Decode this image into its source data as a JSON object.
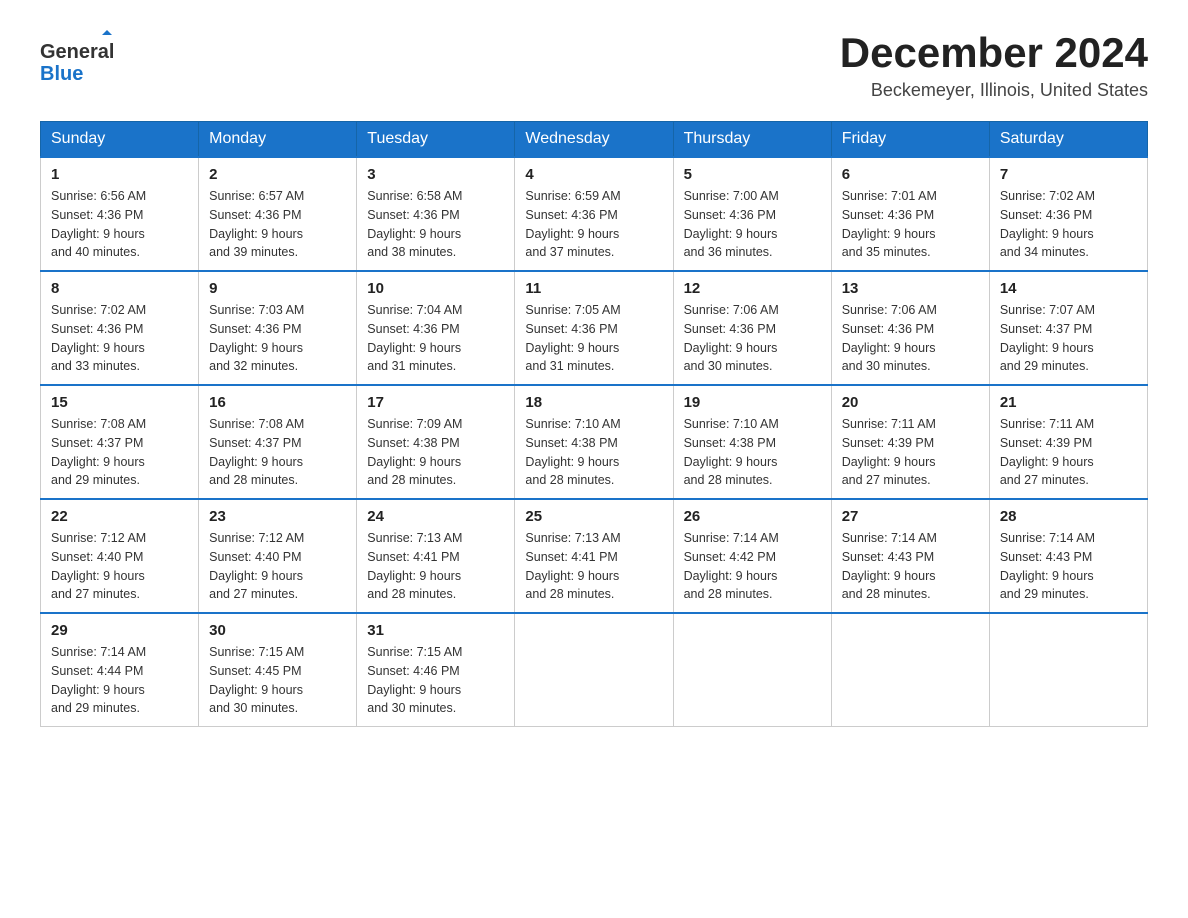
{
  "logo": {
    "text_general": "General",
    "text_blue": "Blue"
  },
  "header": {
    "month_title": "December 2024",
    "location": "Beckemeyer, Illinois, United States"
  },
  "days_of_week": [
    "Sunday",
    "Monday",
    "Tuesday",
    "Wednesday",
    "Thursday",
    "Friday",
    "Saturday"
  ],
  "weeks": [
    [
      {
        "day": "1",
        "sunrise": "6:56 AM",
        "sunset": "4:36 PM",
        "daylight": "9 hours and 40 minutes."
      },
      {
        "day": "2",
        "sunrise": "6:57 AM",
        "sunset": "4:36 PM",
        "daylight": "9 hours and 39 minutes."
      },
      {
        "day": "3",
        "sunrise": "6:58 AM",
        "sunset": "4:36 PM",
        "daylight": "9 hours and 38 minutes."
      },
      {
        "day": "4",
        "sunrise": "6:59 AM",
        "sunset": "4:36 PM",
        "daylight": "9 hours and 37 minutes."
      },
      {
        "day": "5",
        "sunrise": "7:00 AM",
        "sunset": "4:36 PM",
        "daylight": "9 hours and 36 minutes."
      },
      {
        "day": "6",
        "sunrise": "7:01 AM",
        "sunset": "4:36 PM",
        "daylight": "9 hours and 35 minutes."
      },
      {
        "day": "7",
        "sunrise": "7:02 AM",
        "sunset": "4:36 PM",
        "daylight": "9 hours and 34 minutes."
      }
    ],
    [
      {
        "day": "8",
        "sunrise": "7:02 AM",
        "sunset": "4:36 PM",
        "daylight": "9 hours and 33 minutes."
      },
      {
        "day": "9",
        "sunrise": "7:03 AM",
        "sunset": "4:36 PM",
        "daylight": "9 hours and 32 minutes."
      },
      {
        "day": "10",
        "sunrise": "7:04 AM",
        "sunset": "4:36 PM",
        "daylight": "9 hours and 31 minutes."
      },
      {
        "day": "11",
        "sunrise": "7:05 AM",
        "sunset": "4:36 PM",
        "daylight": "9 hours and 31 minutes."
      },
      {
        "day": "12",
        "sunrise": "7:06 AM",
        "sunset": "4:36 PM",
        "daylight": "9 hours and 30 minutes."
      },
      {
        "day": "13",
        "sunrise": "7:06 AM",
        "sunset": "4:36 PM",
        "daylight": "9 hours and 30 minutes."
      },
      {
        "day": "14",
        "sunrise": "7:07 AM",
        "sunset": "4:37 PM",
        "daylight": "9 hours and 29 minutes."
      }
    ],
    [
      {
        "day": "15",
        "sunrise": "7:08 AM",
        "sunset": "4:37 PM",
        "daylight": "9 hours and 29 minutes."
      },
      {
        "day": "16",
        "sunrise": "7:08 AM",
        "sunset": "4:37 PM",
        "daylight": "9 hours and 28 minutes."
      },
      {
        "day": "17",
        "sunrise": "7:09 AM",
        "sunset": "4:38 PM",
        "daylight": "9 hours and 28 minutes."
      },
      {
        "day": "18",
        "sunrise": "7:10 AM",
        "sunset": "4:38 PM",
        "daylight": "9 hours and 28 minutes."
      },
      {
        "day": "19",
        "sunrise": "7:10 AM",
        "sunset": "4:38 PM",
        "daylight": "9 hours and 28 minutes."
      },
      {
        "day": "20",
        "sunrise": "7:11 AM",
        "sunset": "4:39 PM",
        "daylight": "9 hours and 27 minutes."
      },
      {
        "day": "21",
        "sunrise": "7:11 AM",
        "sunset": "4:39 PM",
        "daylight": "9 hours and 27 minutes."
      }
    ],
    [
      {
        "day": "22",
        "sunrise": "7:12 AM",
        "sunset": "4:40 PM",
        "daylight": "9 hours and 27 minutes."
      },
      {
        "day": "23",
        "sunrise": "7:12 AM",
        "sunset": "4:40 PM",
        "daylight": "9 hours and 27 minutes."
      },
      {
        "day": "24",
        "sunrise": "7:13 AM",
        "sunset": "4:41 PM",
        "daylight": "9 hours and 28 minutes."
      },
      {
        "day": "25",
        "sunrise": "7:13 AM",
        "sunset": "4:41 PM",
        "daylight": "9 hours and 28 minutes."
      },
      {
        "day": "26",
        "sunrise": "7:14 AM",
        "sunset": "4:42 PM",
        "daylight": "9 hours and 28 minutes."
      },
      {
        "day": "27",
        "sunrise": "7:14 AM",
        "sunset": "4:43 PM",
        "daylight": "9 hours and 28 minutes."
      },
      {
        "day": "28",
        "sunrise": "7:14 AM",
        "sunset": "4:43 PM",
        "daylight": "9 hours and 29 minutes."
      }
    ],
    [
      {
        "day": "29",
        "sunrise": "7:14 AM",
        "sunset": "4:44 PM",
        "daylight": "9 hours and 29 minutes."
      },
      {
        "day": "30",
        "sunrise": "7:15 AM",
        "sunset": "4:45 PM",
        "daylight": "9 hours and 30 minutes."
      },
      {
        "day": "31",
        "sunrise": "7:15 AM",
        "sunset": "4:46 PM",
        "daylight": "9 hours and 30 minutes."
      },
      null,
      null,
      null,
      null
    ]
  ],
  "labels": {
    "sunrise": "Sunrise:",
    "sunset": "Sunset:",
    "daylight": "Daylight:"
  }
}
